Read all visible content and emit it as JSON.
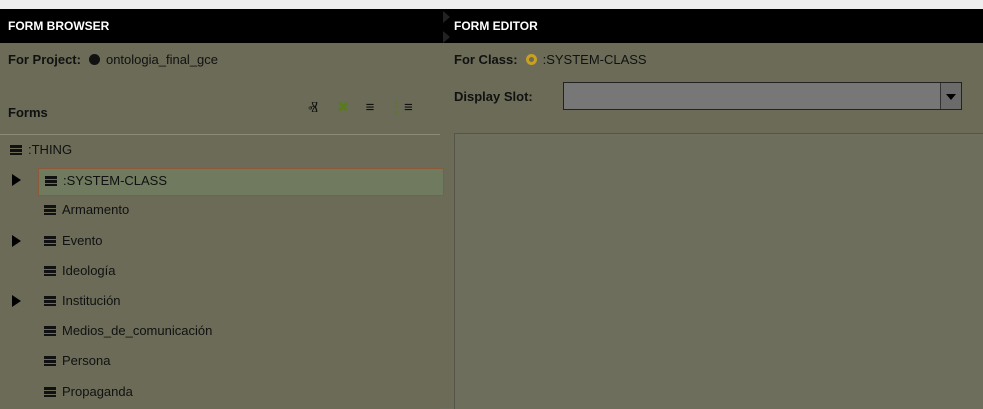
{
  "left": {
    "title": "FORM BROWSER",
    "project_label": "For Project:",
    "project_name": "ontologia_final_gce",
    "project_dot_color": "#111111",
    "forms_label": "Forms",
    "toolbar_icons": [
      "person-search-icon",
      "delete-icon",
      "hide-icon",
      "layout-icon"
    ],
    "tree": [
      {
        "label": ":THING",
        "level": 0,
        "expandable": false,
        "selected": false
      },
      {
        "label": ":SYSTEM-CLASS",
        "level": 1,
        "expandable": true,
        "selected": true
      },
      {
        "label": "Armamento",
        "level": 1,
        "expandable": false,
        "selected": false
      },
      {
        "label": "Evento",
        "level": 1,
        "expandable": true,
        "selected": false
      },
      {
        "label": "Ideología",
        "level": 1,
        "expandable": false,
        "selected": false
      },
      {
        "label": "Institución",
        "level": 1,
        "expandable": true,
        "selected": false
      },
      {
        "label": "Medios_de_comunicación",
        "level": 1,
        "expandable": false,
        "selected": false
      },
      {
        "label": "Persona",
        "level": 1,
        "expandable": false,
        "selected": false
      },
      {
        "label": "Propaganda",
        "level": 1,
        "expandable": false,
        "selected": false
      }
    ]
  },
  "right": {
    "title": "FORM EDITOR",
    "class_label": "For Class:",
    "class_name": ":SYSTEM-CLASS",
    "class_dot_color": "#c9a020",
    "display_slot_label": "Display Slot:",
    "display_slot_value": ""
  }
}
